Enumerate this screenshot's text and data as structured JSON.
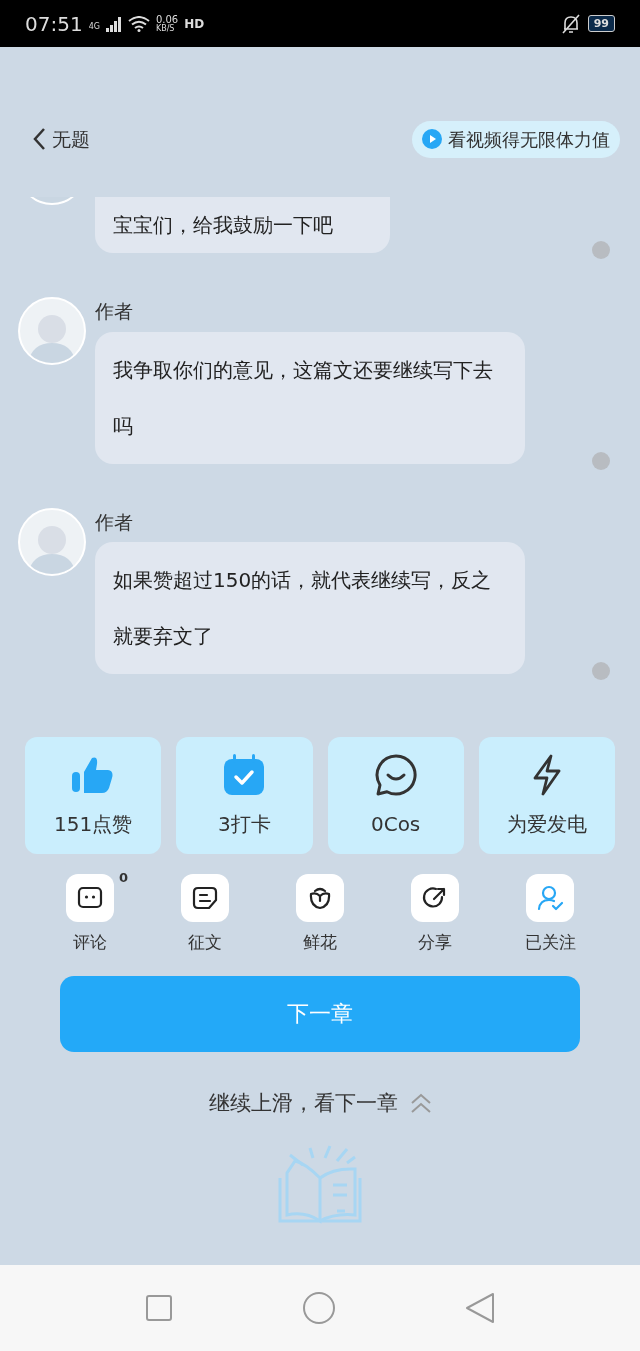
{
  "status_bar": {
    "time": "07:51",
    "network": "4G",
    "speed": "0.06",
    "speed_unit": "KB/S",
    "hd": "HD",
    "battery": "99"
  },
  "header": {
    "title": "无题",
    "promo": "看视频得无限体力值"
  },
  "messages": [
    {
      "text": "宝宝们，给我鼓励一下吧",
      "cut": true
    },
    {
      "author": "作者",
      "text": "我争取你们的意见，这篇文还要继续写下去吗",
      "cut": false
    },
    {
      "author": "作者",
      "text": "如果赞超过150的话，就代表继续写，反之就要弃文了",
      "cut": false
    }
  ],
  "stats": [
    {
      "kind": "like",
      "label": "151点赞"
    },
    {
      "kind": "checkin",
      "label": "3打卡"
    },
    {
      "kind": "cos",
      "label": "0Cos"
    },
    {
      "kind": "power",
      "label": "为爱发电"
    }
  ],
  "actions": [
    {
      "kind": "comment",
      "label": "评论",
      "badge": "0"
    },
    {
      "kind": "essay",
      "label": "征文"
    },
    {
      "kind": "flower",
      "label": "鲜花"
    },
    {
      "kind": "share",
      "label": "分享"
    },
    {
      "kind": "follow",
      "label": "已关注"
    }
  ],
  "next_button": "下一章",
  "swipe_hint": "继续上滑，看下一章"
}
